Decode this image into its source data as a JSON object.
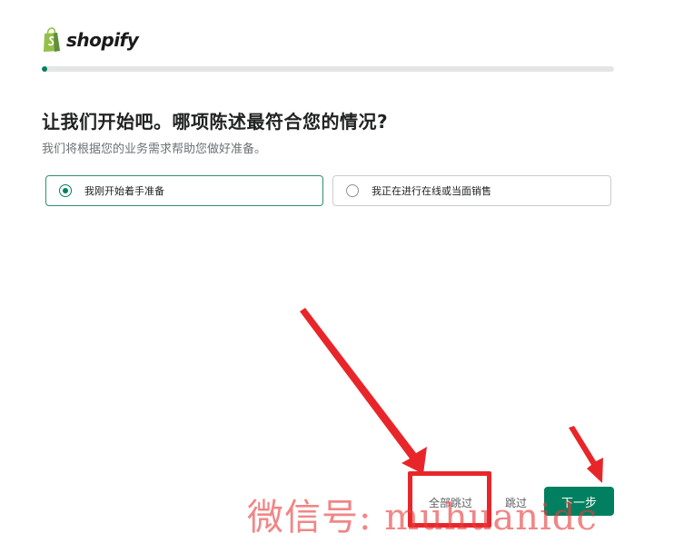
{
  "brand": {
    "name": "shopify",
    "logo_icon": "shopify-bag-icon",
    "colors": {
      "primary": "#008060",
      "bag_light": "#95bf47",
      "bag_dark": "#5e8e3e"
    }
  },
  "progress": {
    "fraction": 0.01
  },
  "question": {
    "title": "让我们开始吧。哪项陈述最符合您的情况?",
    "subtitle": "我们将根据您的业务需求帮助您做好准备。"
  },
  "options": [
    {
      "label": "我刚开始着手准备",
      "selected": true
    },
    {
      "label": "我正在进行在线或当面销售",
      "selected": false
    }
  ],
  "actions": {
    "skip_all_label": "全部跳过",
    "skip_label": "跳过",
    "next_label": "下一步"
  },
  "annotation": {
    "color": "#e8262a",
    "watermark": "微信号: muhuanidc"
  }
}
